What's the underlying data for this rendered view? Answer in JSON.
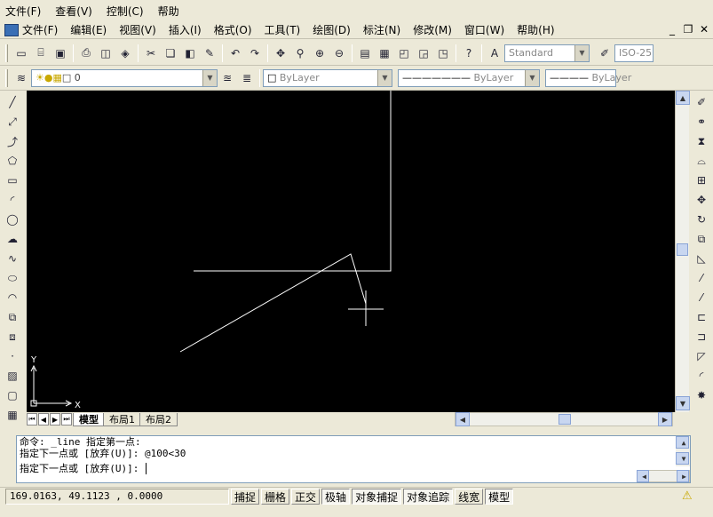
{
  "menu_top": [
    "文件(F)",
    "查看(V)",
    "控制(C)",
    "帮助"
  ],
  "menu_main": [
    "文件(F)",
    "编辑(E)",
    "视图(V)",
    "插入(I)",
    "格式(O)",
    "工具(T)",
    "绘图(D)",
    "标注(N)",
    "修改(M)",
    "窗口(W)",
    "帮助(H)"
  ],
  "window_controls": {
    "minimize": "_",
    "restore": "❐",
    "close": "✕"
  },
  "toolbar1": {
    "text_style": "Standard",
    "dim_style": "ISO-25"
  },
  "toolbar2": {
    "layer": "0",
    "color": "ByLayer",
    "linetype": "ByLayer",
    "lineweight": "ByLayer"
  },
  "ucs": {
    "y_label": "Y",
    "x_label": "X"
  },
  "tabs": [
    "模型",
    "布局1",
    "布局2"
  ],
  "command_lines": [
    "命令: _line 指定第一点:",
    "指定下一点或 [放弃(U)]: @100<30",
    "指定下一点或 [放弃(U)]: "
  ],
  "status": {
    "coords": "169.0163, 49.1123 , 0.0000",
    "buttons": [
      "捕捉",
      "栅格",
      "正交",
      "极轴",
      "对象捕捉",
      "对象追踪",
      "线宽",
      "模型"
    ]
  },
  "colors": {
    "canvas": "#000000",
    "lines": "#ffffff",
    "chrome": "#ece9d8"
  }
}
